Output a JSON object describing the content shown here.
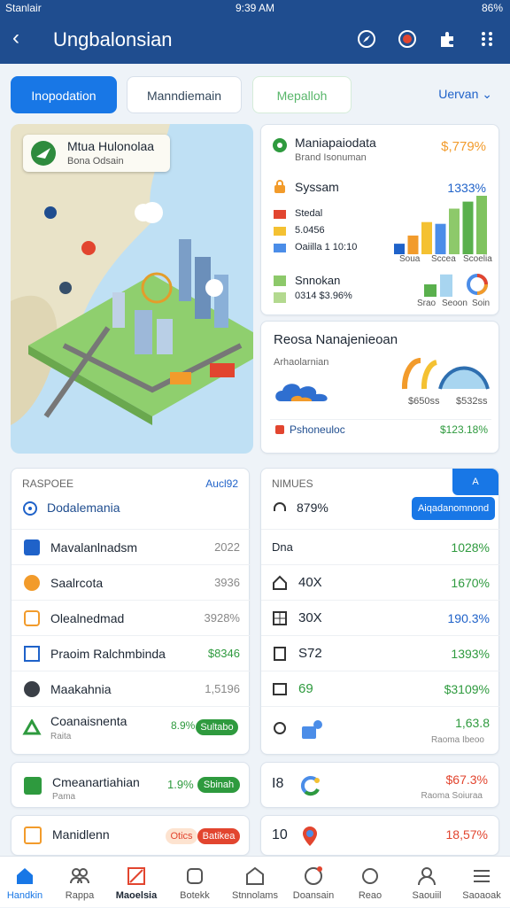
{
  "status": {
    "carrier": "Stanlair",
    "time": "9:39 AM",
    "battery": "86%"
  },
  "header": {
    "title": "Ungbalonsian"
  },
  "tabs": [
    {
      "label": "Inopodation"
    },
    {
      "label": "Manndiemain"
    },
    {
      "label": "Mepalloh"
    }
  ],
  "overview": {
    "label": "Uervan"
  },
  "map": {
    "card_title": "Mtua Hulonolaa",
    "card_sub": "Bona Odsain"
  },
  "summary": {
    "title": "Maniapaiodata",
    "title_value": "$,779%",
    "subtitle": "Brand Isonuman",
    "system_label": "Syssam",
    "system_value": "1333%",
    "legend": [
      "Stedal",
      "5.0456",
      "Oaiilla 1 10:10"
    ],
    "axis": [
      "Soua",
      "Sccea",
      "Scoelia"
    ],
    "bars": [
      0.18,
      0.32,
      0.55,
      0.52,
      0.78,
      0.9,
      1.0
    ],
    "item2_title": "Snnokan",
    "item2_sub": "0314 $3.96%",
    "axis2": [
      "Srao",
      "Seoon",
      "Soin"
    ],
    "bars2": [
      0.5,
      0.9
    ]
  },
  "rev": {
    "title": "Reosa Nanajenieoan",
    "sub": "Arhaolarnian",
    "v1": "$650ss",
    "v2": "$532ss",
    "footer_label": "Pshoneuloc",
    "footer_value": "$123.18%"
  },
  "left_list": {
    "header": "RASPOEE",
    "header_right": "Aucl92",
    "section": "Dodalemania",
    "rows": [
      {
        "label": "Mavalanlnadsm",
        "value": "2022"
      },
      {
        "label": "Saalrcota",
        "value": "3936"
      },
      {
        "label": "Olealnedmad",
        "value": "3928%"
      },
      {
        "label": "Praoim Ralchmbinda",
        "value": "$8346"
      },
      {
        "label": "Maakahnia",
        "value": "1,5196"
      },
      {
        "label": "Coanaisnenta",
        "sub": "Raita",
        "value": "8.9%",
        "pill": "Sultabo"
      }
    ]
  },
  "right_list": {
    "header": "NIMUES",
    "header_btn": "A",
    "pct": "879%",
    "btn": "Aiqadanomnond",
    "rows": [
      {
        "label": "Dna",
        "value": "1028%"
      },
      {
        "label": "40X",
        "value": "1670%"
      },
      {
        "label": "30X",
        "value": "190.3%"
      },
      {
        "label": "S72",
        "value": "1393%"
      },
      {
        "label": "69",
        "value": "$3109%"
      },
      {
        "label": "",
        "value": "1,63.8",
        "sub": "Raoma Ibeoo"
      }
    ]
  },
  "lower_left": [
    {
      "label": "Cmeanartiahian",
      "sub": "Pama",
      "value": "1.9%",
      "pill": "Sbinah"
    },
    {
      "label": "Manidlenn",
      "pill_a": "Otics",
      "pill": "Batikea"
    }
  ],
  "lower_right": [
    {
      "label": "I8",
      "value": "$67.3%",
      "sub": "Raoma Soiuraa"
    },
    {
      "label": "10",
      "value": "18,57%"
    }
  ],
  "nav": [
    {
      "label": "Handkin"
    },
    {
      "label": "Rappa"
    },
    {
      "label": "Maoelsia"
    },
    {
      "label": "Botekk"
    },
    {
      "label": "Stnnolams"
    },
    {
      "label": "Doansain"
    },
    {
      "label": "Reao"
    },
    {
      "label": "Saouiil"
    },
    {
      "label": "Saoaoak"
    }
  ],
  "colors": {
    "primary": "#1f4d8f",
    "accent": "#1877e6",
    "green": "#2e9a3e",
    "orange": "#f29b2b",
    "red": "#e2452f"
  }
}
